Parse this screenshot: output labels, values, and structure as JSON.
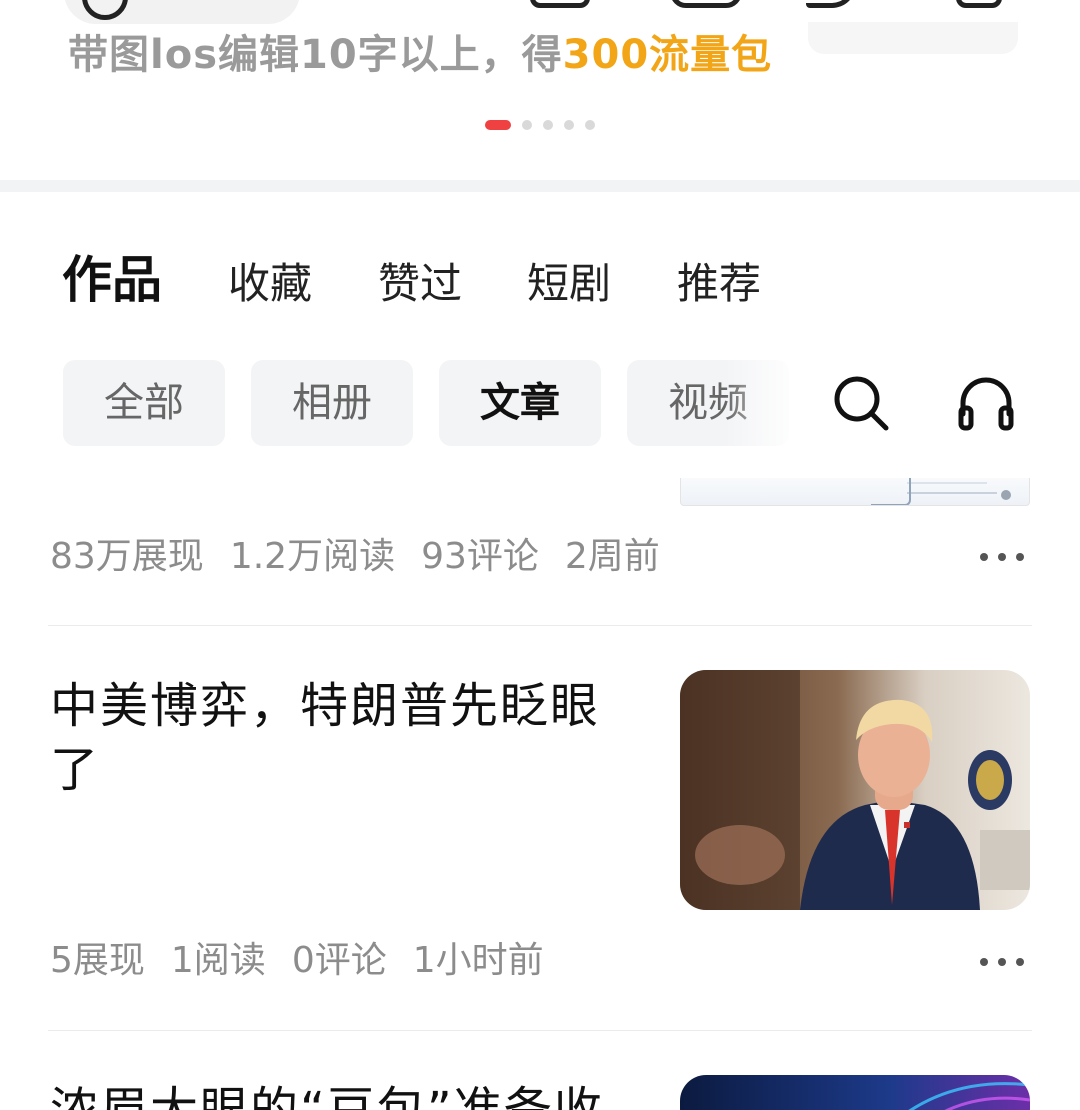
{
  "banner": {
    "text_gray": "带图los编辑10字以上，得",
    "text_highlight": "300流量包",
    "carousel_pages": 5,
    "carousel_active_index": 0
  },
  "main_tabs": [
    {
      "label": "作品",
      "active": true
    },
    {
      "label": "收藏",
      "active": false
    },
    {
      "label": "赞过",
      "active": false
    },
    {
      "label": "短剧",
      "active": false
    },
    {
      "label": "推荐",
      "active": false
    }
  ],
  "filter_chips": [
    {
      "label": "全部",
      "active": false
    },
    {
      "label": "相册",
      "active": false
    },
    {
      "label": "文章",
      "active": true
    },
    {
      "label": "视频",
      "active": false
    }
  ],
  "tools": {
    "search_icon": "search-icon",
    "listen_icon": "headphones-icon"
  },
  "articles": [
    {
      "title": "",
      "stats": {
        "impressions": "83万展现",
        "reads": "1.2万阅读",
        "comments": "93评论",
        "time": "2周前"
      }
    },
    {
      "title": "中美博弈，特朗普先眨眼了",
      "stats": {
        "impressions": "5展现",
        "reads": "1阅读",
        "comments": "0评论",
        "time": "1小时前"
      }
    },
    {
      "title": "浓眉大眼的“豆包”准备收",
      "stats": null
    }
  ],
  "colors": {
    "accent": "#f04142",
    "highlight": "#f2a516",
    "stat_gray": "#8c8c8c"
  }
}
